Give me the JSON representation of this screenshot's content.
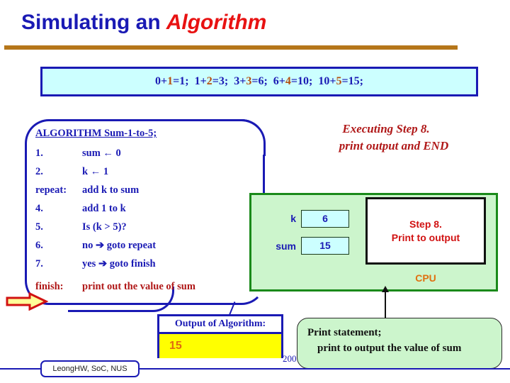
{
  "title": {
    "main": "Simulating an",
    "emphasis": "Algorithm"
  },
  "equation_banner": {
    "terms": [
      {
        "a": "0+",
        "b": "1",
        "rest": "=1;"
      },
      {
        "a": "1+",
        "b": "2",
        "rest": "=3;"
      },
      {
        "a": "3+",
        "b": "3",
        "rest": "=6;"
      },
      {
        "a": "6+",
        "b": "4",
        "rest": "=10;"
      },
      {
        "a": "10+",
        "b": "5",
        "rest": "=15;"
      }
    ],
    "full_text": "0+1=1;  1+2=3;  3+3=6;  6+4=10;  10+5=15;"
  },
  "algorithm": {
    "header": "ALGORITHM Sum-1-to-5;",
    "steps": [
      {
        "label": "1.",
        "text": "sum ← 0"
      },
      {
        "label": "2.",
        "text": "k ← 1"
      },
      {
        "label": "repeat:",
        "text": "add k to sum"
      },
      {
        "label": "4.",
        "text": "add 1 to k"
      },
      {
        "label": "5.",
        "text": "Is (k > 5)?"
      },
      {
        "label": "6.",
        "text": "no ➔ goto repeat"
      },
      {
        "label": "7.",
        "text": "yes ➔ goto finish"
      }
    ],
    "finish": {
      "label": "finish:",
      "text": "print out the value of sum"
    }
  },
  "execution_caption": {
    "line1": "Executing Step 8.",
    "line2": "print output and END"
  },
  "cpu": {
    "variables": [
      {
        "name": "k",
        "value": "6"
      },
      {
        "name": "sum",
        "value": "15"
      }
    ],
    "current_step": "Step 8.\nPrint to output",
    "label": "CPU"
  },
  "output_panel": {
    "header": "Output of Algorithm:",
    "value": "15"
  },
  "print_note": {
    "line1": "Print statement;",
    "line2": "print to output the value of sum"
  },
  "footer": {
    "credit": "LeongHW, SoC, NUS",
    "year_fragment": "200"
  },
  "colors": {
    "title_blue": "#1a1ab4",
    "title_red": "#e81212",
    "rule_brown": "#b5761a",
    "banner_cyan": "#ccffff",
    "cpu_green": "#ccf5cc",
    "cpu_green_border": "#1a8a1a",
    "step_red": "#d11212",
    "cpu_orange": "#e07010",
    "output_yellow": "#ffff00",
    "output_value_orange": "#e06b10",
    "finish_red": "#b01818",
    "operand_brown": "#b5500f"
  }
}
